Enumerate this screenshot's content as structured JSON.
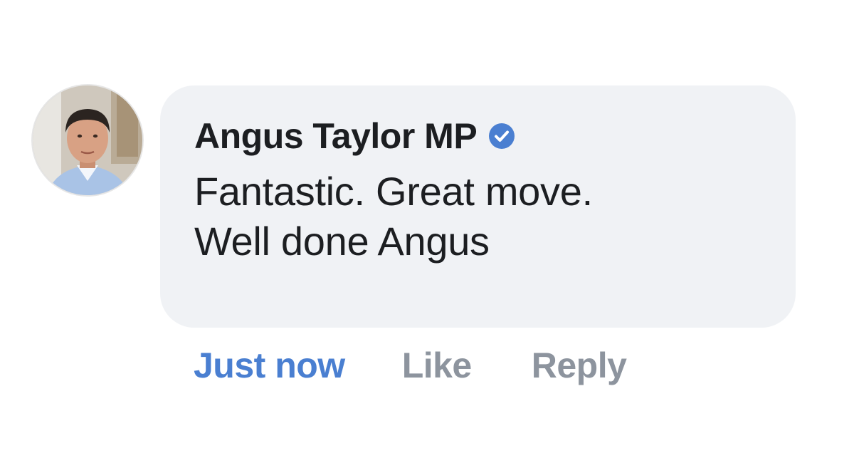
{
  "comment": {
    "author": "Angus Taylor MP",
    "verified": true,
    "text_line_1": "Fantastic. Great move.",
    "text_line_2": "Well done Angus"
  },
  "actions": {
    "timestamp": "Just now",
    "like_label": "Like",
    "reply_label": "Reply"
  },
  "colors": {
    "bubble_background": "#f0f2f5",
    "timestamp_link": "#4a7fd1",
    "action_gray": "#8d949e",
    "verified_badge": "#4a7fd1",
    "text": "#1c1e21"
  },
  "icons": {
    "verified": "verified-badge-icon",
    "avatar": "profile-photo"
  }
}
